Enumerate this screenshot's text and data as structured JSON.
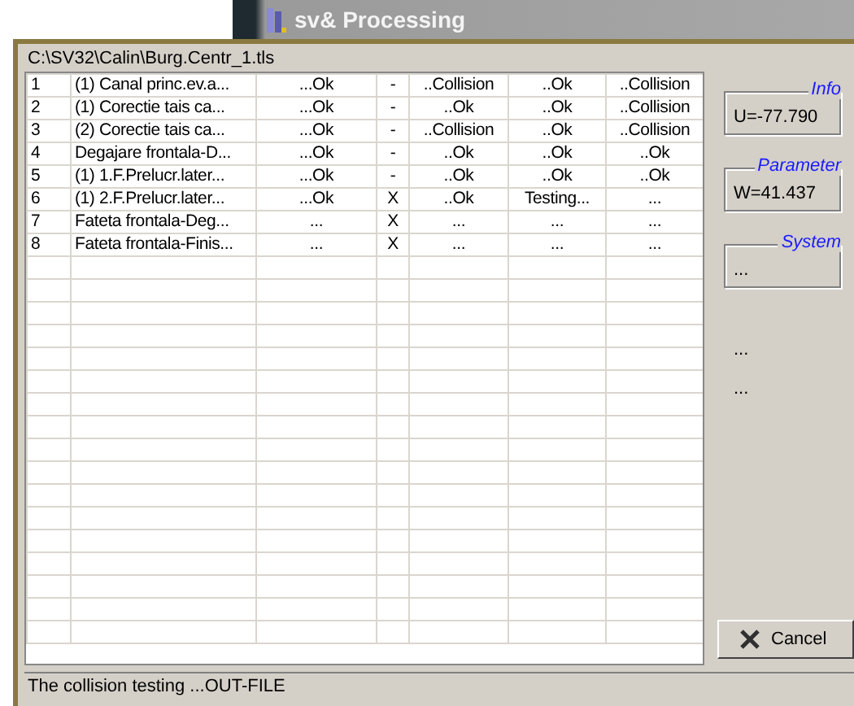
{
  "window": {
    "title": "sv& Processing"
  },
  "path": "C:\\SV32\\Calin\\Burg.Centr_1.tls",
  "table": {
    "rows": [
      {
        "cells": [
          "1",
          "(1) Canal princ.ev.a...",
          "...Ok",
          "-",
          "..Collision",
          "..Ok",
          "..Collision"
        ]
      },
      {
        "cells": [
          "2",
          "(1) Corectie tais ca...",
          "...Ok",
          "-",
          "..Ok",
          "..Ok",
          "..Collision"
        ]
      },
      {
        "cells": [
          "3",
          "(2) Corectie tais ca...",
          "...Ok",
          "-",
          "..Collision",
          "..Ok",
          "..Collision"
        ]
      },
      {
        "cells": [
          "4",
          "Degajare frontala-D...",
          "...Ok",
          "-",
          "..Ok",
          "..Ok",
          "..Ok"
        ]
      },
      {
        "cells": [
          "5",
          "(1) 1.F.Prelucr.later...",
          "...Ok",
          "-",
          "..Ok",
          "..Ok",
          "..Ok"
        ]
      },
      {
        "cells": [
          "6",
          "(1) 2.F.Prelucr.later...",
          "...Ok",
          "X",
          "..Ok",
          "Testing...",
          "..."
        ]
      },
      {
        "cells": [
          "7",
          "Fateta frontala-Deg...",
          "...",
          "X",
          "...",
          "...",
          "..."
        ]
      },
      {
        "cells": [
          "8",
          "Fateta frontala-Finis...",
          "...",
          "X",
          "...",
          "...",
          "..."
        ]
      }
    ]
  },
  "groups": [
    {
      "legend": "Info",
      "value": "U=-77.790"
    },
    {
      "legend": "Parameter",
      "value": "W=41.437"
    },
    {
      "legend": "System",
      "value": "..."
    }
  ],
  "side_texts": [
    "...",
    "..."
  ],
  "cancel_button": "Cancel",
  "status_bar": "The collision testing ...OUT-FILE"
}
